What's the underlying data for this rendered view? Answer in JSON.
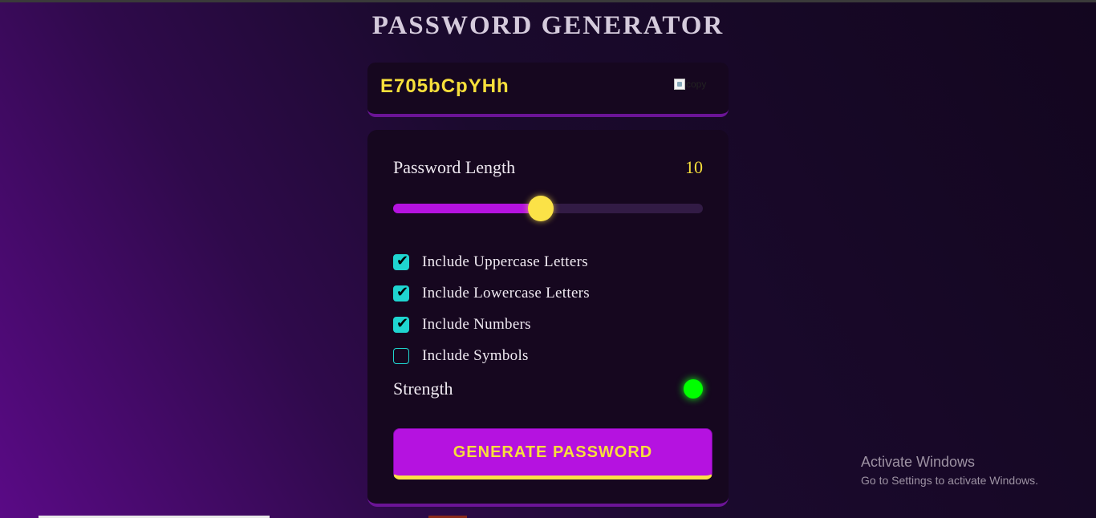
{
  "page_title": "PASSWORD GENERATOR",
  "display": {
    "password": "E705bCpYHh",
    "copy_alt": "copy"
  },
  "length": {
    "label": "Password Length",
    "value": "10",
    "slider_fraction": 0.477
  },
  "options": [
    {
      "label": "Include Uppercase Letters",
      "checked": true
    },
    {
      "label": "Include Lowercase Letters",
      "checked": true
    },
    {
      "label": "Include Numbers",
      "checked": true
    },
    {
      "label": "Include Symbols",
      "checked": false
    }
  ],
  "strength": {
    "label": "Strength",
    "color": "#00ff00"
  },
  "generate_label": "GENERATE PASSWORD",
  "watermark": {
    "line1": "Activate Windows",
    "line2": "Go to Settings to activate Windows."
  },
  "colors": {
    "accent": "#b512e0",
    "highlight": "#f7df3b",
    "checkbox": "#1fd5d0"
  }
}
